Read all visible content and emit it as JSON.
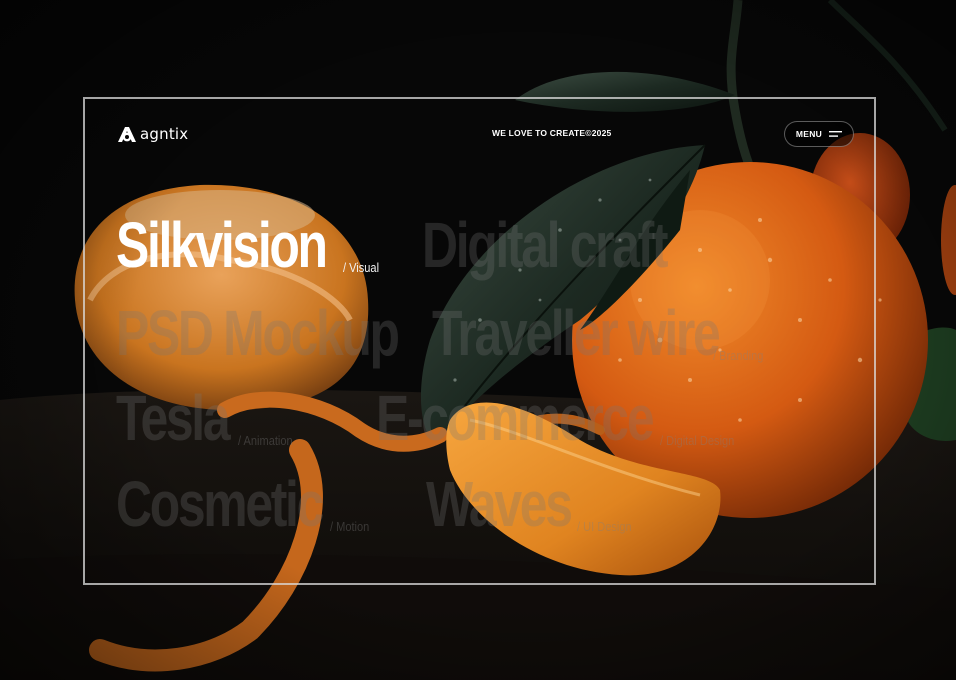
{
  "brand": {
    "name": "agntix"
  },
  "header": {
    "tagline": "WE LOVE TO CREATE©2025",
    "menu_label": "MENU"
  },
  "projects": [
    {
      "title": "Silkvision",
      "category": "/ Visual",
      "active": true
    },
    {
      "title": "Digital craft",
      "category": "",
      "active": false
    },
    {
      "title": "PSD Mockup",
      "category": "",
      "active": false
    },
    {
      "title": "Traveller wire",
      "category": "/ Branding",
      "active": false
    },
    {
      "title": "Tesla",
      "category": "/ Animation",
      "active": false
    },
    {
      "title": "E-commerce",
      "category": "/ Digital Design",
      "active": false
    },
    {
      "title": "Cosmetic",
      "category": "/ Motion",
      "active": false
    },
    {
      "title": "Waves",
      "category": "/ UI Design",
      "active": false
    }
  ],
  "colors": {
    "background": "#050505",
    "frame_border": "#dcdcdc",
    "accent_orange": "#d65a14"
  },
  "icons": {
    "logo_mark": "agntix-logo-icon",
    "menu": "hamburger-icon"
  }
}
